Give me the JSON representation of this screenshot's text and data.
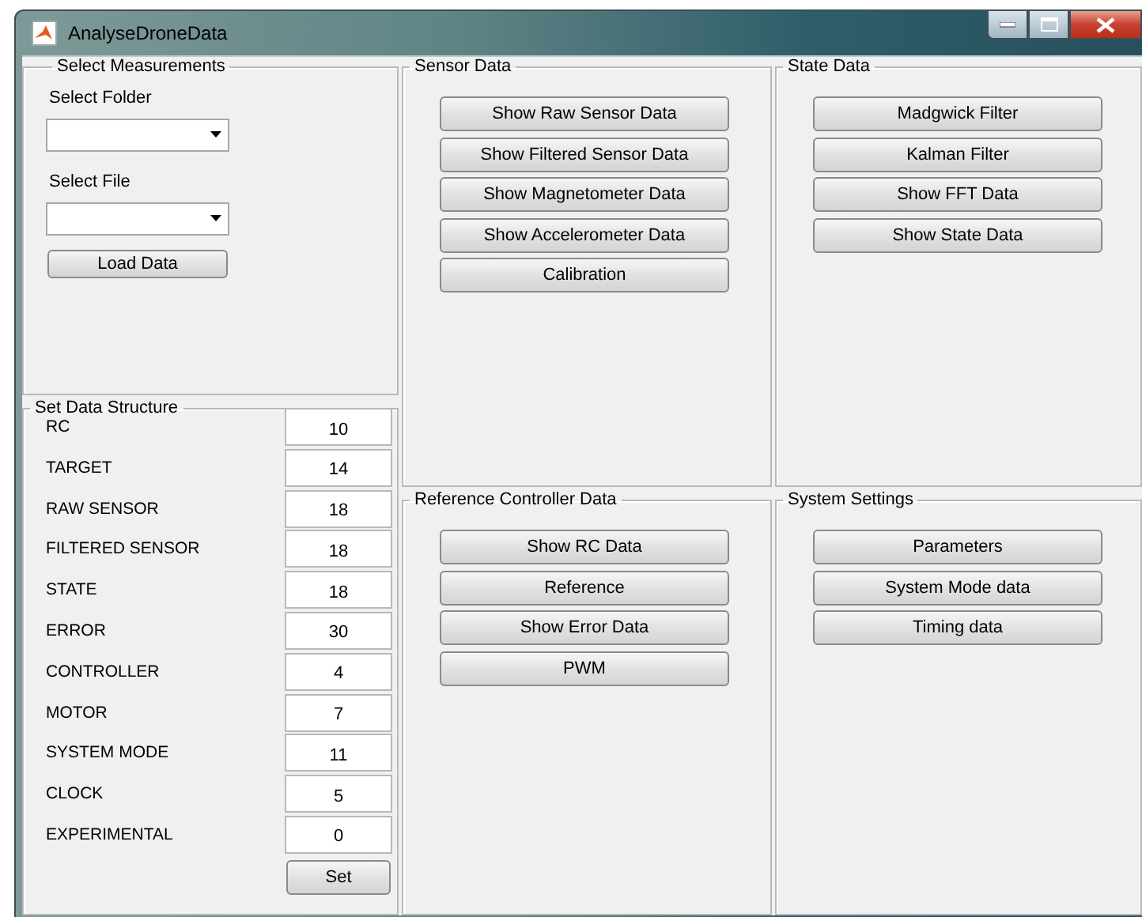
{
  "window": {
    "title": "AnalyseDroneData"
  },
  "select_measurements": {
    "title": "Select Measurements",
    "dropdowns": [
      {
        "label": "Select Folder"
      },
      {
        "label": "Select File"
      }
    ],
    "button": "Load Data"
  },
  "set_data_structure": {
    "title": "Set Data Structure",
    "rows": [
      {
        "label": "RC",
        "value": "10"
      },
      {
        "label": "TARGET",
        "value": "14"
      },
      {
        "label": "RAW SENSOR",
        "value": "18"
      },
      {
        "label": "FILTERED SENSOR",
        "value": "18"
      },
      {
        "label": "STATE",
        "value": "18"
      },
      {
        "label": "ERROR",
        "value": "30"
      },
      {
        "label": "CONTROLLER",
        "value": "4"
      },
      {
        "label": "MOTOR",
        "value": "7"
      },
      {
        "label": "SYSTEM MODE",
        "value": "11"
      },
      {
        "label": "CLOCK",
        "value": "5"
      },
      {
        "label": "EXPERIMENTAL",
        "value": "0"
      }
    ],
    "button": "Set"
  },
  "sensor_data": {
    "title": "Sensor Data",
    "buttons": [
      "Show Raw Sensor Data",
      "Show Filtered Sensor Data",
      "Show Magnetometer Data",
      "Show Accelerometer Data",
      "Calibration"
    ]
  },
  "state_data": {
    "title": "State Data",
    "buttons": [
      "Madgwick Filter",
      "Kalman Filter",
      "Show FFT Data",
      "Show State Data"
    ]
  },
  "reference_controller_data": {
    "title": "Reference Controller Data",
    "buttons": [
      "Show RC Data",
      "Reference",
      "Show Error Data",
      "PWM"
    ]
  },
  "system_settings": {
    "title": "System Settings",
    "buttons": [
      "Parameters",
      "System Mode data",
      "Timing data"
    ]
  }
}
